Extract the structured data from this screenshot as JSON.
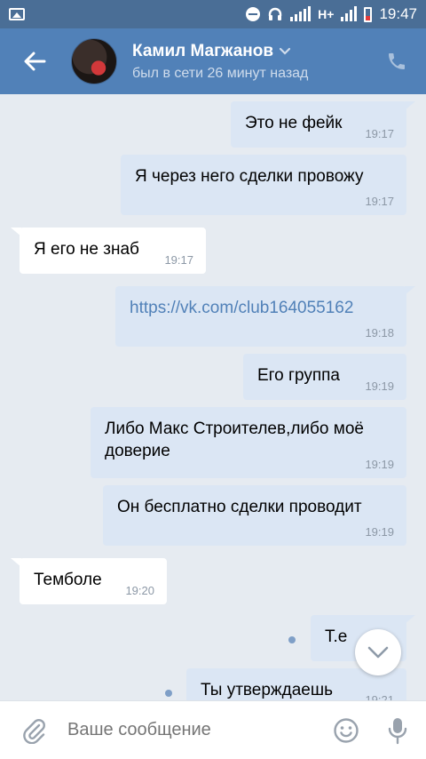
{
  "statusbar": {
    "network": "H+",
    "time": "19:47",
    "battery_color": "#e23b3b"
  },
  "header": {
    "contact_name": "Камил Магжанов",
    "status": "был в сети 26 минут назад",
    "brand_color": "#5181b8"
  },
  "messages": [
    {
      "direction": "out",
      "text": "Это не фейк",
      "time": "19:17"
    },
    {
      "direction": "out",
      "text": "Я через него сделки провожу",
      "time": "19:17"
    },
    {
      "direction": "in",
      "text": "Я его не знаб",
      "time": "19:17"
    },
    {
      "direction": "out",
      "text": "https://vk.com/club164055162",
      "time": "19:18",
      "is_link": true
    },
    {
      "direction": "out",
      "text": "Его группа",
      "time": "19:19"
    },
    {
      "direction": "out",
      "text": "Либо Макс Строителев,либо моё доверие",
      "time": "19:19"
    },
    {
      "direction": "out",
      "text": "Он бесплатно сделки проводит",
      "time": "19:19"
    },
    {
      "direction": "in",
      "text": "Темболе",
      "time": "19:20"
    },
    {
      "direction": "out",
      "text": "Т.е",
      "time": "",
      "unread": true
    },
    {
      "direction": "out",
      "text": "Ты утверждаешь",
      "time": "19:21",
      "unread": true
    }
  ],
  "composer": {
    "placeholder": "Ваше сообщение"
  },
  "icons": {
    "back": "arrow-left-icon",
    "call": "phone-icon",
    "attach": "paperclip-icon",
    "emoji": "smile-icon",
    "mic": "microphone-icon",
    "scroll_down": "chevron-down-icon"
  }
}
